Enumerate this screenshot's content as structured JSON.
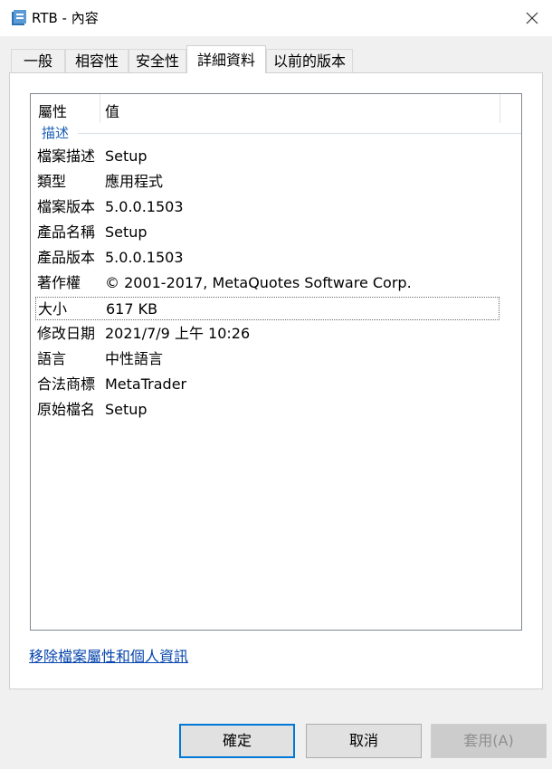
{
  "window": {
    "title": "RTB - 內容"
  },
  "tabs": [
    {
      "label": "一般"
    },
    {
      "label": "相容性"
    },
    {
      "label": "安全性"
    },
    {
      "label": "詳細資料"
    },
    {
      "label": "以前的版本"
    }
  ],
  "details": {
    "header": {
      "property": "屬性",
      "value": "值"
    },
    "group": "描述",
    "rows": [
      {
        "key": "檔案描述",
        "value": "Setup"
      },
      {
        "key": "類型",
        "value": "應用程式"
      },
      {
        "key": "檔案版本",
        "value": "5.0.0.1503"
      },
      {
        "key": "產品名稱",
        "value": "Setup"
      },
      {
        "key": "產品版本",
        "value": "5.0.0.1503"
      },
      {
        "key": "著作權",
        "value": "© 2001-2017, MetaQuotes Software Corp."
      },
      {
        "key": "大小",
        "value": "617 KB"
      },
      {
        "key": "修改日期",
        "value": "2021/7/9 上午 10:26"
      },
      {
        "key": "語言",
        "value": "中性語言"
      },
      {
        "key": "合法商標",
        "value": "MetaTrader"
      },
      {
        "key": "原始檔名",
        "value": "Setup"
      }
    ]
  },
  "remove_link": "移除檔案屬性和個人資訊",
  "buttons": {
    "ok": "確定",
    "cancel": "取消",
    "apply": "套用(A)"
  },
  "icons": {
    "app": "app-file-icon",
    "close": "close-icon"
  },
  "colors": {
    "accent": "#0078d7",
    "link": "#0645ad",
    "group": "#1a5fb4"
  }
}
